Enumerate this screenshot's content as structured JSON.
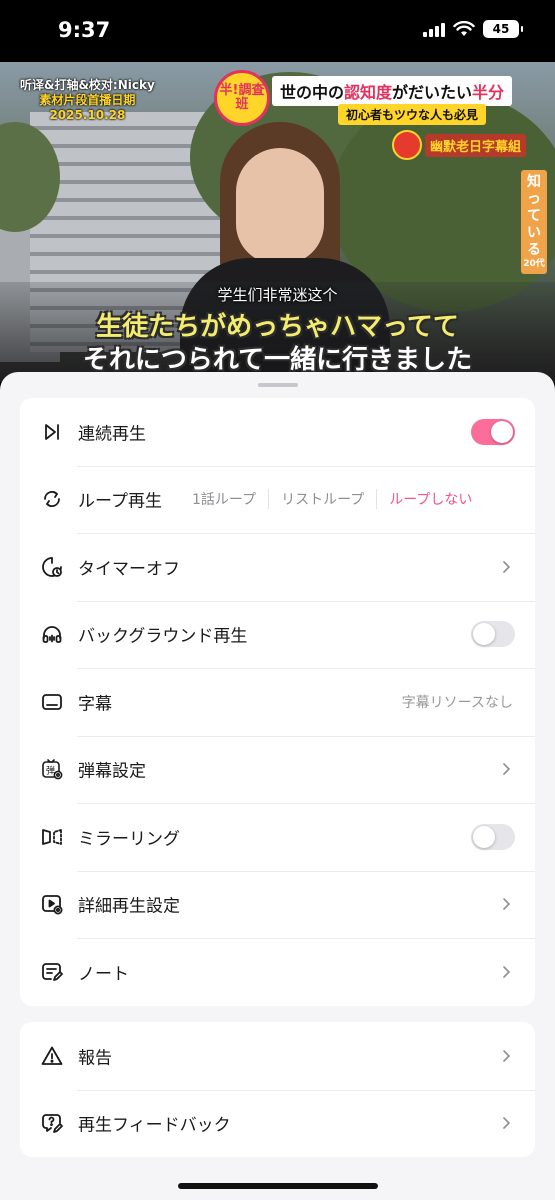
{
  "status_bar": {
    "time": "9:37",
    "battery": "45"
  },
  "video": {
    "credit_line1": "听译&打轴&校对:Nicky",
    "credit_line2": "素材片段首播日期",
    "credit_line3": "2025.10.28",
    "show_logo": "半!調査班",
    "headline_part1": "世の中の",
    "headline_highlight1": "認知度",
    "headline_part2": "がだいたい",
    "headline_highlight2": "半分",
    "subhead": "初心者もツウな人も必見",
    "sub_group": "幽默老日字幕組",
    "side_caption": "知っている",
    "side_caption_age": "20代",
    "subtitle_cn": "学生们非常迷这个",
    "subtitle_jp_line1": "生徒たちがめっちゃハマってて",
    "subtitle_jp_line2": "それにつられて一緒に行きました"
  },
  "settings": {
    "continuous_play": {
      "label": "連続再生",
      "enabled": true
    },
    "loop_play": {
      "label": "ループ再生",
      "options": [
        "1話ループ",
        "リストループ",
        "ループしない"
      ],
      "selected": "ループしない"
    },
    "timer": {
      "label": "タイマーオフ"
    },
    "background_play": {
      "label": "バックグラウンド再生",
      "enabled": false
    },
    "subtitles": {
      "label": "字幕",
      "value": "字幕リソースなし"
    },
    "danmaku": {
      "label": "弾幕設定"
    },
    "mirroring": {
      "label": "ミラーリング",
      "enabled": false
    },
    "advanced_playback": {
      "label": "詳細再生設定"
    },
    "notes": {
      "label": "ノート"
    }
  },
  "support": {
    "report": {
      "label": "報告"
    },
    "feedback": {
      "label": "再生フィードバック"
    }
  },
  "colors": {
    "accent": "#f2558d",
    "toggle_on": "#fb6e99",
    "sheet_bg": "#f5f5f7"
  },
  "icons": {
    "continuous_play": "skip-forward-icon",
    "loop_play": "repeat-icon",
    "timer": "timer-icon",
    "background_play": "headphones-icon",
    "subtitles": "subtitles-icon",
    "danmaku": "danmaku-settings-icon",
    "mirroring": "mirror-icon",
    "advanced_playback": "play-settings-icon",
    "notes": "note-icon",
    "report": "warning-icon",
    "feedback": "feedback-icon"
  }
}
